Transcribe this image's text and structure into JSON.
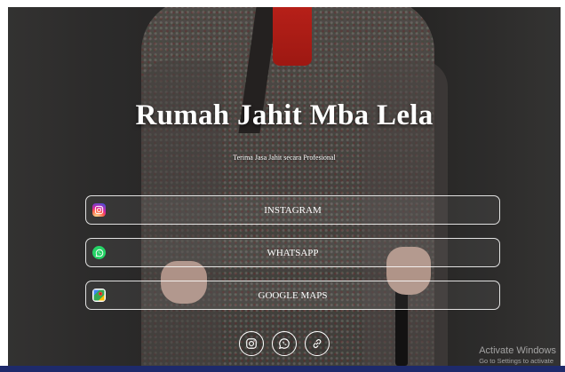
{
  "page": {
    "title": "Rumah Jahit Mba Lela",
    "subtitle": "Terima Jasa Jahit secara Profesional"
  },
  "links": [
    {
      "label": "INSTAGRAM",
      "icon": "instagram-icon"
    },
    {
      "label": "WHATSAPP",
      "icon": "whatsapp-icon"
    },
    {
      "label": "GOOGLE MAPS",
      "icon": "google-maps-icon"
    }
  ],
  "socials": [
    {
      "icon": "instagram-icon"
    },
    {
      "icon": "whatsapp-icon"
    },
    {
      "icon": "link-icon"
    }
  ],
  "watermark": {
    "line1": "Activate Windows",
    "line2": "Go to Settings to activate"
  },
  "colors": {
    "text": "#ffffff",
    "whatsapp": "#25d366",
    "taskbar": "#1e2a6b"
  }
}
